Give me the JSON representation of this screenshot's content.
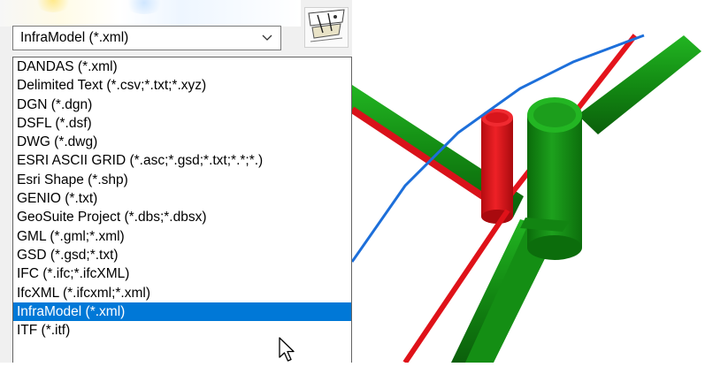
{
  "format_combo": {
    "selected": "InfraModel (*.xml)",
    "icon": "chevron-down-icon"
  },
  "format_list": {
    "items": [
      {
        "label": "DANDAS (*.xml)",
        "selected": false
      },
      {
        "label": "Delimited Text (*.csv;*.txt;*.xyz)",
        "selected": false
      },
      {
        "label": "DGN (*.dgn)",
        "selected": false
      },
      {
        "label": "DSFL (*.dsf)",
        "selected": false
      },
      {
        "label": "DWG (*.dwg)",
        "selected": false
      },
      {
        "label": "ESRI ASCII GRID (*.asc;*.gsd;*.txt;*.*;*.)",
        "selected": false
      },
      {
        "label": "Esri Shape (*.shp)",
        "selected": false
      },
      {
        "label": "GENIO (*.txt)",
        "selected": false
      },
      {
        "label": "GeoSuite Project (*.dbs;*.dbsx)",
        "selected": false
      },
      {
        "label": "GML (*.gml;*.xml)",
        "selected": false
      },
      {
        "label": "GSD (*.gsd;*.txt)",
        "selected": false
      },
      {
        "label": "IFC (*.ifc;*.ifcXML)",
        "selected": false
      },
      {
        "label": "IfcXML (*.ifcxml;*.xml)",
        "selected": false
      },
      {
        "label": "InfraModel (*.xml)",
        "selected": true
      },
      {
        "label": "ITF (*.itf)",
        "selected": false
      }
    ],
    "selected_color": "#0078d7"
  },
  "view3d": {
    "pipe_colors": {
      "blue": "#1a6fd6",
      "red": "#e8151b",
      "green": "#1aa31a"
    }
  }
}
